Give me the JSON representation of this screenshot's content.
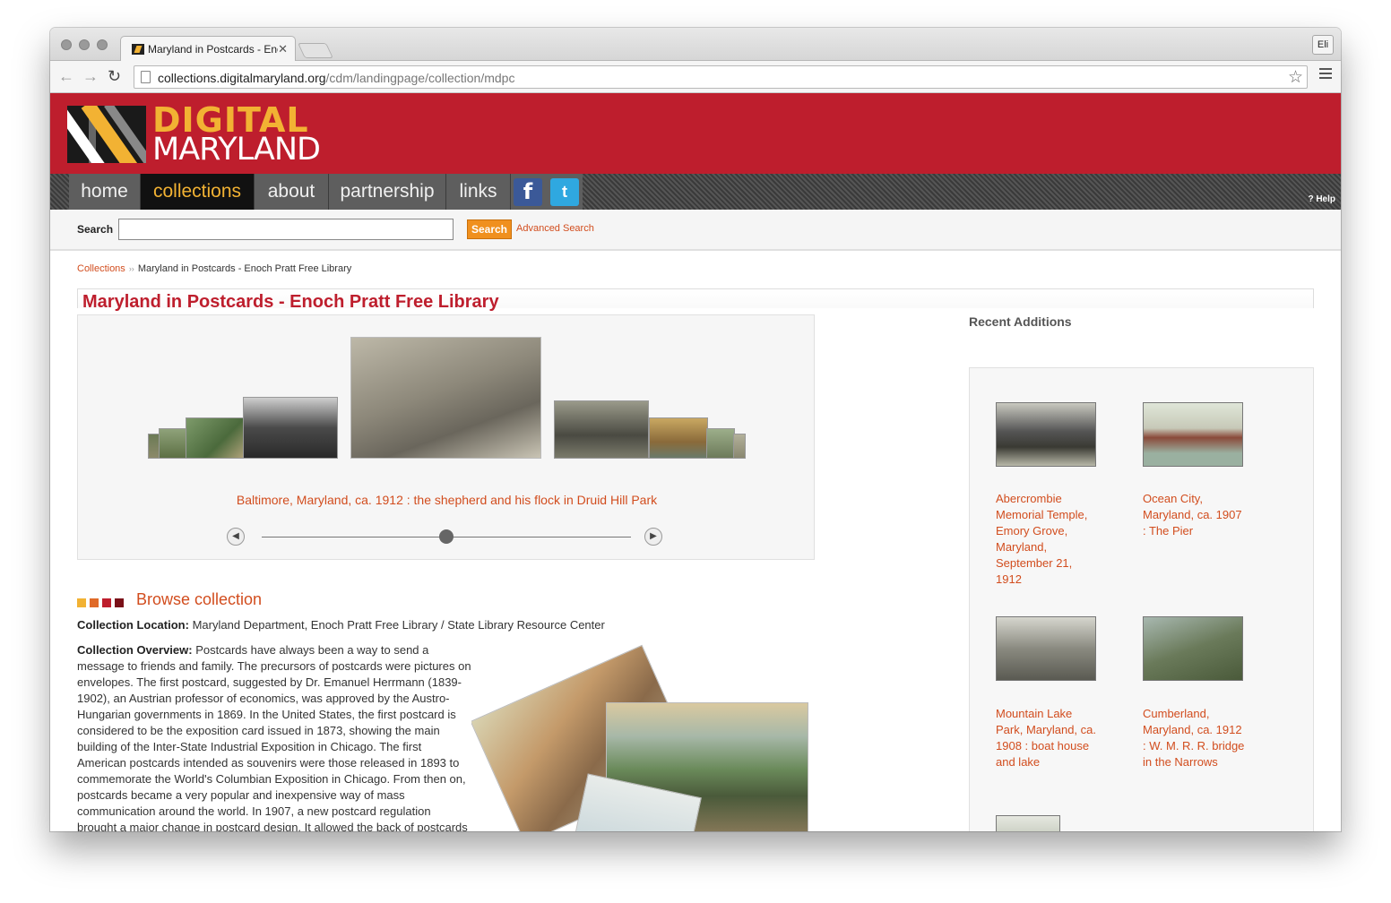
{
  "browser": {
    "tab_title": "Maryland in Postcards - Enoch Pratt Free Library",
    "tab_close": "✕",
    "profile": "Eli",
    "url_host": "collections.digitalmaryland.org",
    "url_path": "/cdm/landingpage/collection/mdpc",
    "back": "←",
    "forward": "→",
    "reload": "↻",
    "star": "☆"
  },
  "header": {
    "logo_line1": "DIGITAL",
    "logo_line2": "MARYLAND"
  },
  "nav": {
    "items": [
      "home",
      "collections",
      "about",
      "partnership",
      "links"
    ],
    "active": "collections",
    "facebook": "f",
    "twitter": "t",
    "help": "Help",
    "help_icon": "?"
  },
  "search": {
    "label": "Search",
    "value": "",
    "button": "Search",
    "advanced": "Advanced Search"
  },
  "breadcrumb": {
    "root": "Collections",
    "separator": "››",
    "current": "Maryland in Postcards - Enoch Pratt Free Library"
  },
  "page": {
    "title": "Maryland in Postcards - Enoch Pratt Free Library"
  },
  "carousel": {
    "caption": "Baltimore, Maryland, ca. 1912 : the shepherd and his flock in Druid Hill Park",
    "prev_icon": "◀",
    "next_icon": "▶",
    "position": 0.5
  },
  "recent": {
    "title": "Recent Additions",
    "items": [
      {
        "caption": "Abercrombie Memorial Temple, Emory Grove, Maryland, September 21, 1912"
      },
      {
        "caption": "Ocean City, Maryland, ca. 1907 : The Pier"
      },
      {
        "caption": "Mountain Lake Park, Maryland, ca. 1908 : boat house and lake"
      },
      {
        "caption": "Cumberland, Maryland, ca. 1912 : W. M. R. R. bridge in the Narrows"
      }
    ]
  },
  "browse": {
    "label": "Browse collection",
    "square_colors": [
      "#f2b233",
      "#e06a28",
      "#be1e2d",
      "#7a1018"
    ]
  },
  "collection": {
    "location_label": "Collection Location:",
    "location_value": "Maryland Department, Enoch Pratt Free Library / State Library Resource Center",
    "overview_label": "Collection Overview:",
    "overview_text": "Postcards have always been a way to send a message to friends and family. The precursors of postcards were pictures on envelopes. The first postcard, suggested by Dr. Emanuel Herrmann (1839-1902), an Austrian professor of economics, was approved by the Austro-Hungarian governments in 1869. In the United States, the first postcard is considered to be the exposition card issued in 1873, showing the main building of the Inter-State Industrial Exposition in Chicago. The first American postcards intended as souvenirs were those released in 1893 to commemorate the World's Columbian Exposition in Chicago. From then on, postcards became a very popular and inexpensive way of mass communication around the world. In 1907, a new postcard regulation brought a major change in postcard design. It allowed the back of postcards"
  },
  "colors": {
    "brand_red": "#be1e2d",
    "brand_gold": "#f2b233",
    "link_orange": "#d24d1e"
  }
}
